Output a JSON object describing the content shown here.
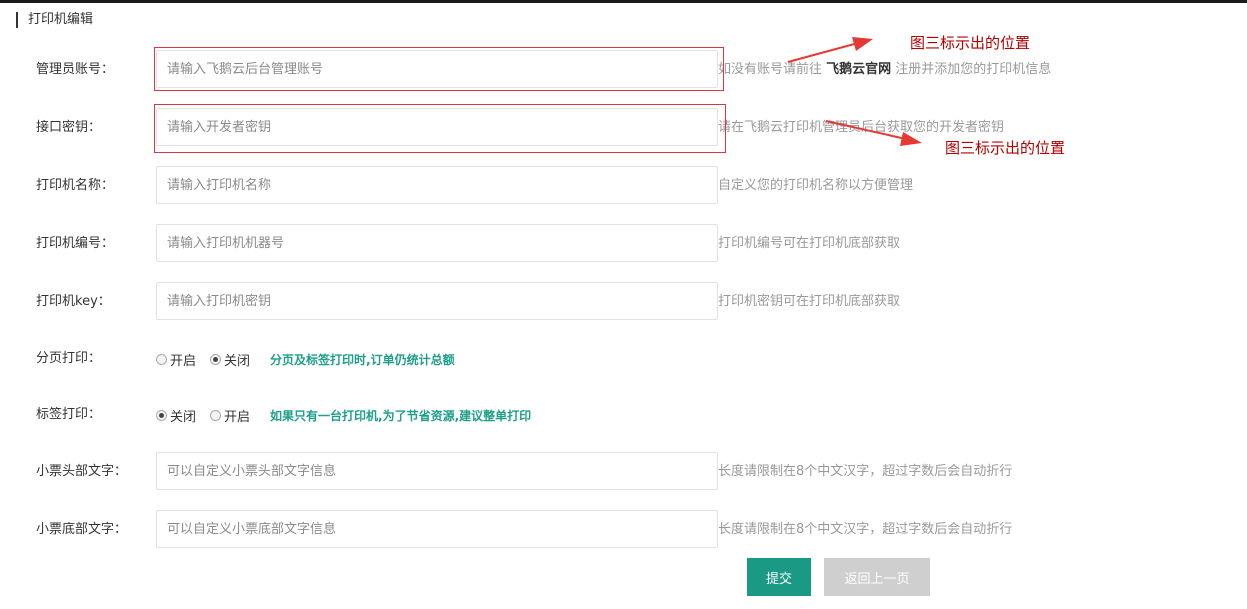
{
  "section_title": "打印机编辑",
  "fields": {
    "admin_account": {
      "label": "管理员账号：",
      "placeholder": "请输入飞鹅云后台管理账号",
      "hint_before": "如没有账号请前往 ",
      "hint_link": "飞鹅云官网",
      "hint_after": " 注册并添加您的打印机信息"
    },
    "api_key": {
      "label": "接口密钥：",
      "placeholder": "请输入开发者密钥",
      "hint": "请在飞鹅云打印机管理员后台获取您的开发者密钥"
    },
    "printer_name": {
      "label": "打印机名称：",
      "placeholder": "请输入打印机名称",
      "hint": "自定义您的打印机名称以方便管理"
    },
    "printer_number": {
      "label": "打印机编号：",
      "placeholder": "请输入打印机机器号",
      "hint": "打印机编号可在打印机底部获取"
    },
    "printer_key": {
      "label": "打印机key：",
      "placeholder": "请输入打印机密钥",
      "hint": "打印机密钥可在打印机底部获取"
    },
    "paging_print": {
      "label": "分页打印：",
      "option_on": "开启",
      "option_off": "关闭",
      "selected": "关闭",
      "note": "分页及标签打印时,订单仍统计总额"
    },
    "label_print": {
      "label": "标签打印：",
      "option_off": "关闭",
      "option_on": "开启",
      "selected": "关闭",
      "note": "如果只有一台打印机,为了节省资源,建议整单打印"
    },
    "receipt_header": {
      "label": "小票头部文字：",
      "placeholder": "可以自定义小票头部文字信息",
      "hint": "长度请限制在8个中文汉字，超过字数后会自动折行"
    },
    "receipt_footer": {
      "label": "小票底部文字：",
      "placeholder": "可以自定义小票底部文字信息",
      "hint": "长度请限制在8个中文汉字，超过字数后会自动折行"
    }
  },
  "buttons": {
    "submit": "提交",
    "back": "返回上一页"
  },
  "annotations": {
    "first": "图三标示出的位置",
    "second": "图三标示出的位置"
  },
  "colors": {
    "accent": "#1a9985",
    "annotation": "#b00000",
    "highlight_box": "#d9363e",
    "note_green": "#1f9e8a"
  }
}
